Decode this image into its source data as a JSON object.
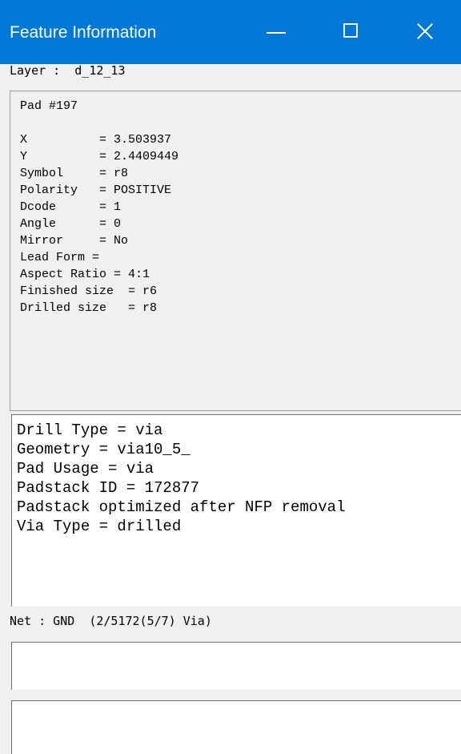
{
  "window": {
    "title": "Feature Information",
    "minimize_glyph": "minimize-icon",
    "maximize_glyph": "maximize-icon",
    "close_glyph": "close-icon",
    "titlebar_color": "#0078d7"
  },
  "layer_line": "Layer :  d_12_13",
  "properties": {
    "header": "Pad #197",
    "lines": [
      "X          = 3.503937",
      "Y          = 2.4409449",
      "Symbol     = r8",
      "Polarity   = POSITIVE",
      "Dcode      = 1",
      "Angle      = 0",
      "Mirror     = No",
      "Lead Form =",
      "Aspect Ratio = 4:1",
      "Finished size  = r6",
      "Drilled size   = r8"
    ]
  },
  "attributes": [
    "Drill Type = via",
    "Geometry = via10_5_",
    "Pad Usage = via",
    "Padstack ID = 172877",
    "Padstack optimized after NFP removal",
    "Via Type = drilled"
  ],
  "net_line": "Net : GND  (2/5172(5/7) Via)"
}
